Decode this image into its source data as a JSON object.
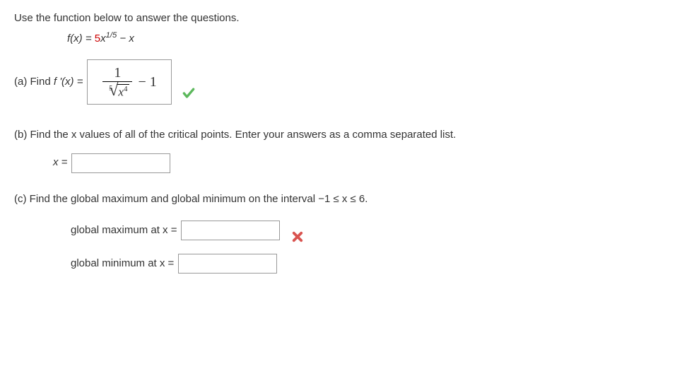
{
  "intro": "Use the function below to answer the questions.",
  "func": {
    "lhs": "f(x) = ",
    "coef": "5",
    "var": "x",
    "exp": "1/5",
    "tail": " − x"
  },
  "partA": {
    "label": "(a) Find ",
    "fprime": "f '(x) = ",
    "answer": {
      "numerator": "1",
      "root_index": "5",
      "radicand_base": "x",
      "radicand_exp": "4",
      "tail": " − 1"
    },
    "status": "correct"
  },
  "partB": {
    "text": "(b) Find the x values of all of the critical points. Enter your answers as a comma separated list.",
    "input_label": "x = ",
    "value": ""
  },
  "partC": {
    "text": "(c) Find the global maximum and global minimum on the interval −1 ≤ x ≤ 6.",
    "max_label": "global maximum at x = ",
    "max_value": "",
    "min_label": "global minimum at x = ",
    "min_value": "",
    "status": "incorrect"
  }
}
